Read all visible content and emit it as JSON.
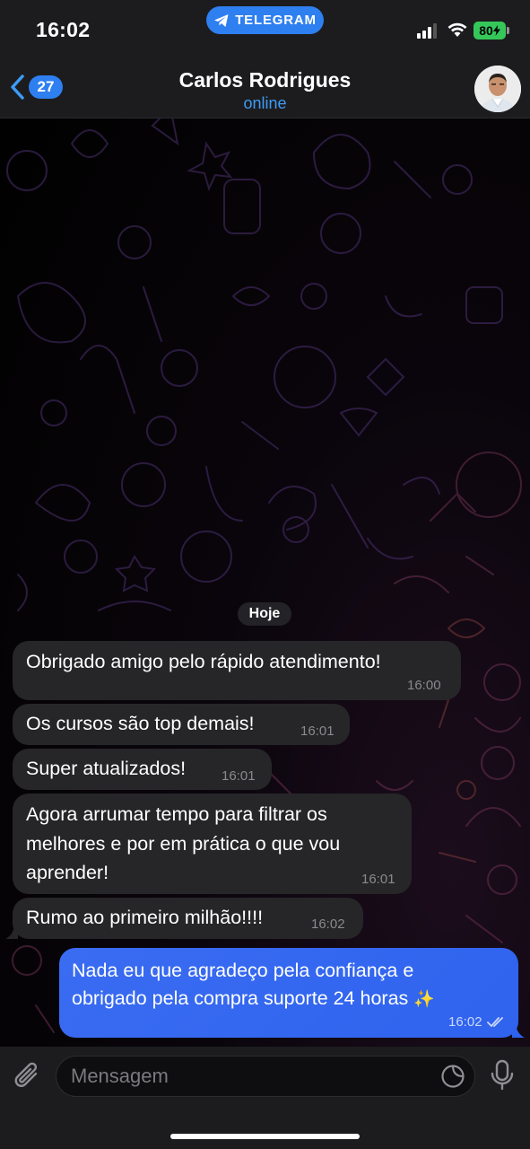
{
  "status_bar": {
    "time": "16:02",
    "app_pill": "TELEGRAM",
    "battery": "80",
    "colors": {
      "pill": "#2e7ff0",
      "battery": "#35c759"
    }
  },
  "header": {
    "back_count": "27",
    "contact_name": "Carlos Rodrigues",
    "contact_status": "online",
    "colors": {
      "accent": "#3e9bf5",
      "badge": "#2e7ff0"
    }
  },
  "chat": {
    "date_label": "Hoje",
    "messages": [
      {
        "direction": "in",
        "lines": [
          "Obrigado amigo pelo rápido atendimento!"
        ],
        "time": "16:00"
      },
      {
        "direction": "in",
        "lines": [
          "Os cursos são top demais!"
        ],
        "time": "16:01"
      },
      {
        "direction": "in",
        "lines": [
          "Super atualizados!"
        ],
        "time": "16:01"
      },
      {
        "direction": "in",
        "lines": [
          "Agora arrumar tempo para filtrar os",
          "melhores e por em prática o que vou",
          "aprender!"
        ],
        "time": "16:01"
      },
      {
        "direction": "in",
        "lines": [
          "Rumo ao primeiro milhão!!!!"
        ],
        "time": "16:02"
      },
      {
        "direction": "out",
        "lines": [
          "Nada eu que agradeço pela confiança e",
          "obrigado pela compra suporte 24 horas"
        ],
        "emoji": "✨",
        "time": "16:02",
        "read": true
      }
    ],
    "colors": {
      "incoming": "#262628",
      "outgoing": "#3366f0"
    }
  },
  "input": {
    "placeholder": "Mensagem"
  },
  "icons": {
    "back": "chevron-left-icon",
    "attach": "paperclip-icon",
    "sticker": "sticker-icon",
    "mic": "microphone-icon",
    "read_receipt": "double-check-icon"
  }
}
